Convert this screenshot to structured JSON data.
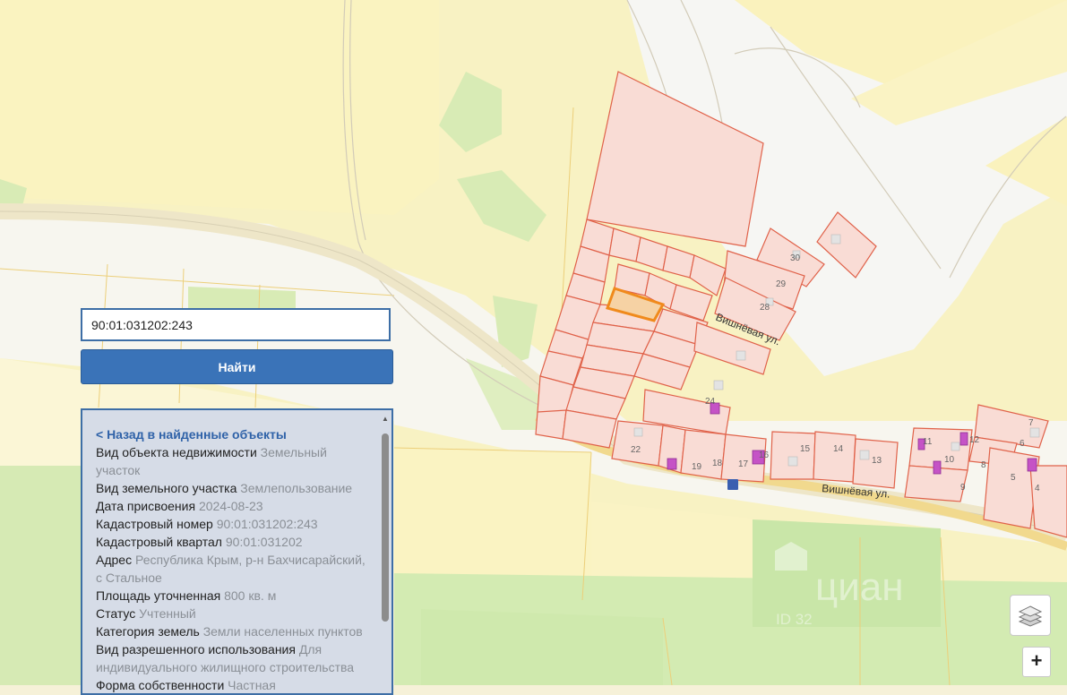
{
  "search": {
    "value": "90:01:031202:243"
  },
  "find_button": {
    "label": "Найти"
  },
  "info": {
    "back_link": "< Назад в найденные объекты",
    "rows": [
      {
        "label": "Вид объекта недвижимости",
        "value": "Земельный участок"
      },
      {
        "label": "Вид земельного участка",
        "value": "Землепользование"
      },
      {
        "label": "Дата присвоения",
        "value": "2024-08-23"
      },
      {
        "label": "Кадастровый номер",
        "value": "90:01:031202:243"
      },
      {
        "label": "Кадастровый квартал",
        "value": "90:01:031202"
      },
      {
        "label": "Адрес",
        "value": "Республика Крым, р-н Бахчисарайский, с Стальное"
      },
      {
        "label": "Площадь уточненная",
        "value": "800 кв. м"
      },
      {
        "label": "Статус",
        "value": "Учтенный"
      },
      {
        "label": "Категория земель",
        "value": "Земли населенных пунктов"
      },
      {
        "label": "Вид разрешенного использования",
        "value": "Для индивидуального жилищного строительства"
      },
      {
        "label": "Форма собственности",
        "value": "Частная"
      }
    ]
  },
  "map": {
    "street_labels": [
      "Вишнёвая ул.",
      "Вишнёвая ул."
    ],
    "plot_numbers": [
      "30",
      "29",
      "28",
      "24",
      "22",
      "19",
      "18",
      "17",
      "16",
      "15",
      "14",
      "13",
      "12",
      "11",
      "10",
      "9",
      "8",
      "7",
      "6",
      "5",
      "4"
    ],
    "watermark": {
      "brand": "циан",
      "id": "ID 32"
    },
    "colors": {
      "farmland": "#f8f2c2",
      "parcel_fill": "#f9ddd6",
      "parcel_border": "#e0624a",
      "selected_border": "#f08a1c",
      "building": "#c553c6",
      "greenery": "#d9ecb6"
    }
  },
  "controls": {
    "layers_icon": "layers-icon",
    "zoom_in": "+"
  }
}
